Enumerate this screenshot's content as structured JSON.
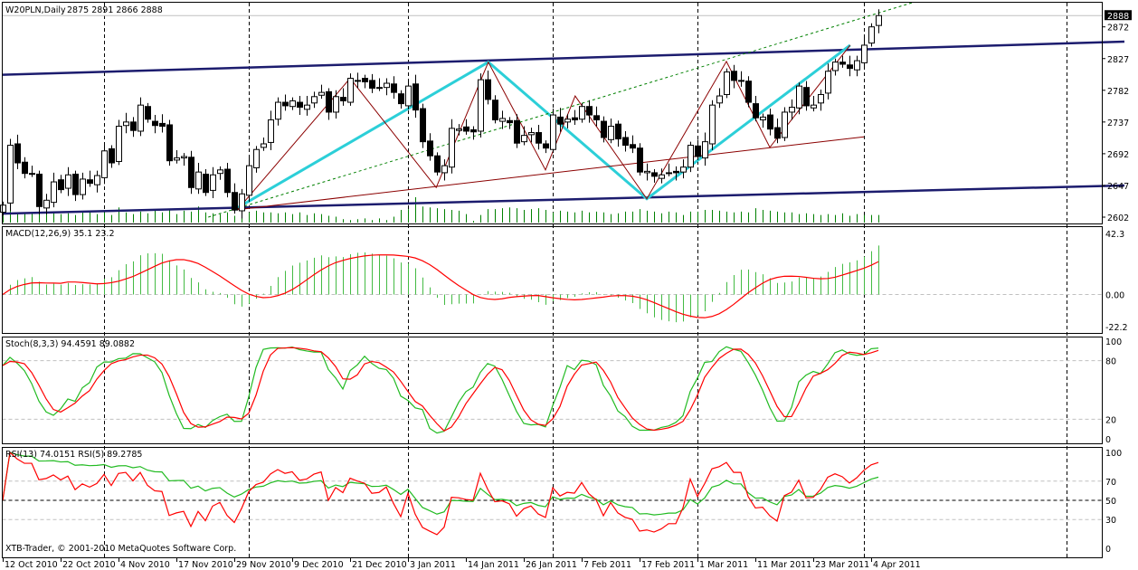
{
  "window": {
    "title": "W20PLN,Daily",
    "ohlc_readout": "2875 2891 2866 2888",
    "copyright": "XTB-Trader, © 2001-2010 MetaQuotes Software Corp."
  },
  "colors": {
    "bull_body": "#ffffff",
    "bear_body": "#000000",
    "volume": "#008000",
    "channel": "#1c1c6e",
    "cyan_line": "#2ccfd8",
    "maroon_line": "#8b0000",
    "green_dotted": "#008000",
    "macd_hist": "#44bb44",
    "signal": "#ff0000",
    "stoch_main": "#22bb22",
    "rsi13": "#22bb22",
    "rsi5": "#ff0000"
  },
  "chart_data": {
    "type": "candlestick",
    "symbol": "W20PLN",
    "timeframe": "Daily",
    "closes": [
      2619,
      2704,
      2679,
      2664,
      2664,
      2617,
      2626,
      2652,
      2641,
      2662,
      2634,
      2656,
      2650,
      2661,
      2696,
      2679,
      2731,
      2737,
      2725,
      2761,
      2741,
      2732,
      2731,
      2682,
      2686,
      2688,
      2644,
      2666,
      2637,
      2662,
      2669,
      2637,
      2612,
      2635,
      2675,
      2698,
      2706,
      2740,
      2765,
      2760,
      2767,
      2758,
      2761,
      2773,
      2779,
      2751,
      2773,
      2767,
      2799,
      2796,
      2794,
      2785,
      2786,
      2792,
      2779,
      2763,
      2788,
      2754,
      2709,
      2689,
      2666,
      2675,
      2728,
      2727,
      2724,
      2723,
      2797,
      2769,
      2740,
      2742,
      2736,
      2707,
      2718,
      2722,
      2707,
      2700,
      2747,
      2734,
      2741,
      2740,
      2759,
      2747,
      2740,
      2715,
      2731,
      2713,
      2704,
      2700,
      2666,
      2667,
      2660,
      2662,
      2665,
      2665,
      2673,
      2704,
      2688,
      2709,
      2761,
      2774,
      2808,
      2796,
      2796,
      2765,
      2743,
      2744,
      2727,
      2714,
      2751,
      2758,
      2788,
      2760,
      2761,
      2776,
      2809,
      2822,
      2819,
      2813,
      2824,
      2846,
      2872,
      2888
    ],
    "volumes": [
      8,
      14,
      11,
      12,
      11,
      10,
      14,
      12,
      10,
      11,
      9,
      12,
      13,
      10,
      12,
      9,
      18,
      12,
      10,
      13,
      11,
      14,
      12,
      16,
      10,
      14,
      13,
      19,
      12,
      11,
      10,
      12,
      8,
      14,
      12,
      14,
      12,
      12,
      11,
      12,
      10,
      12,
      9,
      11,
      10,
      8,
      7,
      4,
      3,
      4,
      5,
      3,
      5,
      3,
      7,
      15,
      16,
      30,
      19,
      18,
      17,
      16,
      15,
      14,
      10,
      2,
      9,
      16,
      16,
      17,
      18,
      17,
      15,
      16,
      17,
      15,
      12,
      14,
      13,
      12,
      14,
      12,
      13,
      12,
      10,
      11,
      13,
      13,
      16,
      14,
      13,
      11,
      13,
      12,
      9,
      13,
      13,
      15,
      15,
      14,
      13,
      12,
      13,
      12,
      17,
      15,
      14,
      13,
      12,
      12,
      10,
      11,
      10,
      9,
      10,
      9,
      11,
      8,
      10,
      9,
      9,
      9
    ],
    "price_axis": {
      "range": [
        2593,
        2905
      ],
      "ticks": [
        "2872",
        "2827",
        "2782",
        "2737",
        "2692",
        "2647",
        "2602"
      ],
      "current": "2888"
    },
    "x_labels": [
      {
        "bar": 0,
        "text": "12 Oct 2010"
      },
      {
        "bar": 8,
        "text": "22 Oct 2010"
      },
      {
        "bar": 16,
        "text": "4 Nov 2010"
      },
      {
        "bar": 24,
        "text": "17 Nov 2010"
      },
      {
        "bar": 32,
        "text": "29 Nov 2010"
      },
      {
        "bar": 40,
        "text": "9 Dec 2010"
      },
      {
        "bar": 48,
        "text": "21 Dec 2010"
      },
      {
        "bar": 56,
        "text": "3 Jan 2011"
      },
      {
        "bar": 64,
        "text": "14 Jan 2011"
      },
      {
        "bar": 72,
        "text": "26 Jan 2011"
      },
      {
        "bar": 80,
        "text": "7 Feb 2011"
      },
      {
        "bar": 88,
        "text": "17 Feb 2011"
      },
      {
        "bar": 96,
        "text": "1 Mar 2011"
      },
      {
        "bar": 104,
        "text": "11 Mar 2011"
      },
      {
        "bar": 112,
        "text": "23 Mar 2011"
      },
      {
        "bar": 120,
        "text": "4 Apr 2011"
      }
    ],
    "period_separators": [
      14,
      34,
      56,
      76,
      96,
      119,
      147
    ],
    "trendlines": [
      {
        "name": "channel-upper",
        "style": "channel",
        "points": [
          [
            0,
            2804
          ],
          [
            155,
            2851
          ]
        ]
      },
      {
        "name": "channel-lower",
        "style": "channel",
        "points": [
          [
            0,
            2607
          ],
          [
            155,
            2647
          ]
        ]
      },
      {
        "name": "cyan-zigzag",
        "style": "cyan",
        "points": [
          [
            31.9,
            2612
          ],
          [
            67.1,
            2822
          ],
          [
            89,
            2628
          ],
          [
            117.1,
            2846
          ]
        ]
      },
      {
        "name": "maroon-zigzag",
        "style": "maroon",
        "points": [
          [
            32.4,
            2612
          ],
          [
            48,
            2799
          ],
          [
            59.9,
            2644
          ],
          [
            67.1,
            2822
          ],
          [
            75,
            2669
          ],
          [
            79.1,
            2774
          ],
          [
            89,
            2628
          ],
          [
            100,
            2823
          ],
          [
            106,
            2701
          ],
          [
            117.1,
            2846
          ]
        ]
      },
      {
        "name": "maroon-support",
        "style": "maroon",
        "points": [
          [
            31.9,
            2612
          ],
          [
            119,
            2716
          ]
        ]
      },
      {
        "name": "green-dotted-trend",
        "style": "dotted",
        "points": [
          [
            28.4,
            2602
          ],
          [
            125.9,
            2907
          ]
        ]
      }
    ],
    "indicators": {
      "macd": {
        "label": "MACD(12,26,9) 35.1 23.2",
        "range": [
          -22.2,
          42.3
        ],
        "ticks": [
          "42.3",
          "0.00",
          "-22.2"
        ]
      },
      "stoch": {
        "label": "Stoch(8,3,3) 94.4591 89.0882",
        "range": [
          0,
          100
        ],
        "ticks": [
          "100",
          "80",
          "20",
          "0"
        ]
      },
      "rsi": {
        "label": "RSI(13) 74.0151  RSI(5) 89.2785",
        "range": [
          0,
          100
        ],
        "ticks": [
          "100",
          "70",
          "50",
          "30",
          "0"
        ]
      }
    }
  }
}
